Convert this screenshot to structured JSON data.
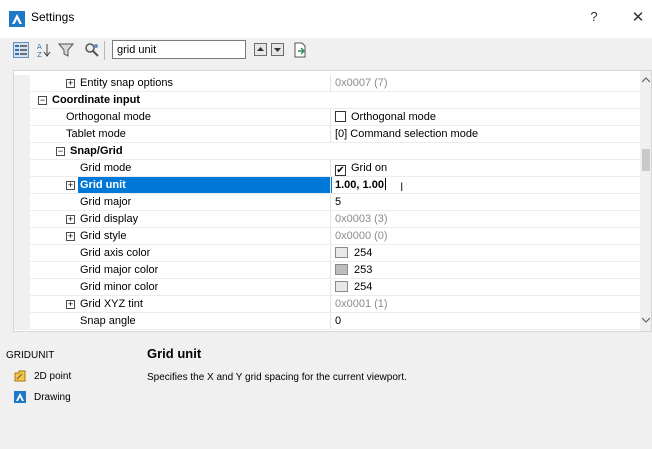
{
  "window": {
    "title": "Settings",
    "help_label": "?",
    "close_label": "✕"
  },
  "toolbar": {
    "search_value": "grid unit"
  },
  "rows": [
    {
      "name": "Entity snap options",
      "value": "0x0007 (7)"
    },
    {
      "name": "Coordinate input",
      "value": ""
    },
    {
      "name": "Orthogonal mode",
      "value": "Orthogonal mode"
    },
    {
      "name": "Tablet mode",
      "value": "[0] Command selection mode"
    },
    {
      "name": "Snap/Grid",
      "value": ""
    },
    {
      "name": "Grid mode",
      "value": "Grid on"
    },
    {
      "name": "Grid unit",
      "value": "1.00, 1.00"
    },
    {
      "name": "Grid major",
      "value": "5"
    },
    {
      "name": "Grid display",
      "value": "0x0003 (3)"
    },
    {
      "name": "Grid style",
      "value": "0x0000 (0)"
    },
    {
      "name": "Grid axis color",
      "value": "254"
    },
    {
      "name": "Grid major color",
      "value": "253"
    },
    {
      "name": "Grid minor color",
      "value": "254"
    },
    {
      "name": "Grid XYZ tint",
      "value": "0x0001 (1)"
    },
    {
      "name": "Snap angle",
      "value": "0"
    }
  ],
  "description": {
    "variable": "GRIDUNIT",
    "title": "Grid unit",
    "text": "Specifies the X and Y grid spacing for the current viewport.",
    "type_label": "2D point",
    "section_label": "Drawing"
  },
  "colors": {
    "selection": "#0078d7",
    "accent": "#1e78c8",
    "swatch_254": "#e8e8e8",
    "swatch_253": "#bdbdbd"
  }
}
